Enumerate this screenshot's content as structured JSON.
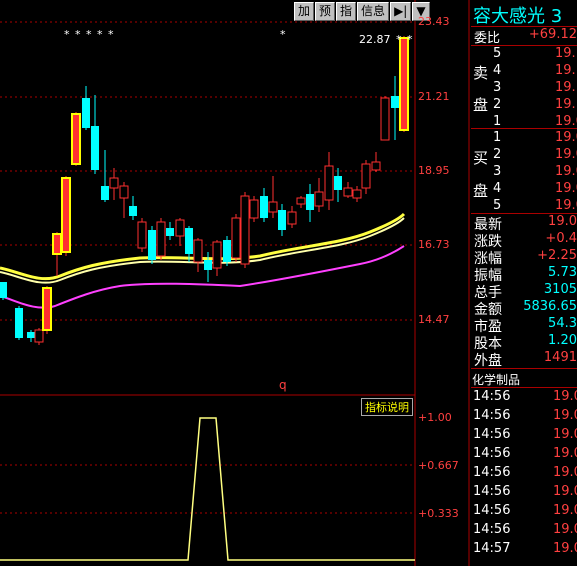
{
  "toolbar": {
    "btn_add": "加",
    "btn_forecast": "预",
    "btn_indicator": "指",
    "btn_info": "信息",
    "btn_jump": "▶|",
    "btn_menu": "▼"
  },
  "chart": {
    "price_ticks": [
      "23.43",
      "21.21",
      "18.95",
      "16.73",
      "14.47"
    ],
    "high_label": "22.87",
    "stars_left": "* * * *   *",
    "stars_mid": "*",
    "stars_right": "* *",
    "marker_q": "q",
    "indicator_title": "指标说明",
    "indicator_ticks": [
      "+1.00",
      "+0.667",
      "+0.333"
    ],
    "colors": {
      "up": "#ff3030",
      "down": "#00ffff",
      "limit": "#ffff00",
      "ma1": "#ffff40",
      "ma2": "#ff40ff",
      "grid": "#aa0000"
    }
  },
  "panel": {
    "title": "容大感光 3",
    "weibi_label": "委比",
    "weibi_value": "+69.12",
    "sell_label_1": "卖",
    "sell_label_2": "盘",
    "buy_label_1": "买",
    "buy_label_2": "盘",
    "sell_levels": [
      {
        "lvl": "5",
        "price": "19."
      },
      {
        "lvl": "4",
        "price": "19."
      },
      {
        "lvl": "3",
        "price": "19."
      },
      {
        "lvl": "2",
        "price": "19."
      },
      {
        "lvl": "1",
        "price": "19.0"
      }
    ],
    "buy_levels": [
      {
        "lvl": "1",
        "price": "19.0"
      },
      {
        "lvl": "2",
        "price": "19.0"
      },
      {
        "lvl": "3",
        "price": "19.0"
      },
      {
        "lvl": "4",
        "price": "19.0"
      },
      {
        "lvl": "5",
        "price": "19.0"
      }
    ],
    "stats": [
      {
        "k": "最新",
        "v": "19.0"
      },
      {
        "k": "涨跌",
        "v": "+0.4"
      },
      {
        "k": "涨幅",
        "v": "+2.25"
      },
      {
        "k": "振幅",
        "v": "5.73"
      },
      {
        "k": "总手",
        "v": "3105"
      },
      {
        "k": "金额",
        "v": "5836.65"
      },
      {
        "k": "市盈",
        "v": "54.3"
      },
      {
        "k": "股本",
        "v": "1.20"
      },
      {
        "k": "外盘",
        "v": "1491"
      }
    ],
    "sector": "化学制品",
    "ticks": [
      {
        "t": "14:56",
        "p": "19.0"
      },
      {
        "t": "14:56",
        "p": "19.0"
      },
      {
        "t": "14:56",
        "p": "19.0"
      },
      {
        "t": "14:56",
        "p": "19.0"
      },
      {
        "t": "14:56",
        "p": "19.0"
      },
      {
        "t": "14:56",
        "p": "19.0"
      },
      {
        "t": "14:56",
        "p": "19.0"
      },
      {
        "t": "14:56",
        "p": "19.0"
      },
      {
        "t": "14:57",
        "p": "19.0"
      }
    ]
  }
}
